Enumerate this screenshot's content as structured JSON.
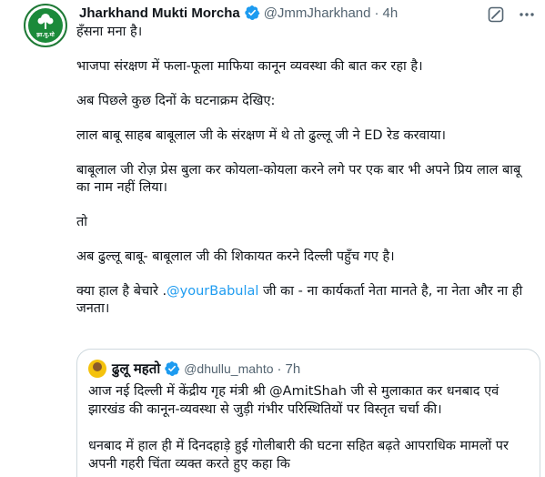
{
  "tweet": {
    "name": "Jharkhand Mukti Morcha",
    "handle": "@JmmJharkhand",
    "separator": "·",
    "time": "4h",
    "avatar_text": "झा.मु.मो",
    "paragraphs": [
      "हँसना मना है।",
      "भाजपा संरक्षण में फला-फूला माफिया कानून व्यवस्था की बात कर रहा है।",
      "अब पिछले कुछ दिनों के घटनाक्रम देखिए:",
      "लाल बाबू साहब बाबूलाल जी के संरक्षण में थे तो ढुल्लू जी ने ED रेड करवाया।",
      "बाबूलाल जी रोज़ प्रेस बुला कर कोयला-कोयला करने लगे पर एक बार भी अपने प्रिय लाल बाबू का नाम नहीं लिया।",
      "तो",
      "अब ढुल्लू बाबू- बाबूलाल जी की शिकायत करने दिल्ली पहुँच गए है।"
    ],
    "last_paragraph": {
      "before": "क्या हाल है बेचारे .",
      "mention": "@yourBabulal",
      "after": " जी का - ना कार्यकर्ता नेता मानते है, ना नेता और ना ही जनता।"
    }
  },
  "quote": {
    "name": "ढुलू महतो",
    "handle": "@dhullu_mahto",
    "separator": "·",
    "time": "7h",
    "paragraphs": [
      "आज नई दिल्ली में केंद्रीय गृह मंत्री श्री @AmitShah जी से मुलाकात कर धनबाद एवं झारखंड की कानून-व्यवस्था से जुड़ी गंभीर परिस्थितियों पर विस्तृत चर्चा की।",
      "धनबाद में हाल ही में दिनदहाड़े हुई गोलीबारी की घटना सहित बढ़ते आपराधिक मामलों पर अपनी गहरी चिंता व्यक्त करते हुए कहा कि"
    ]
  },
  "icons": {
    "verified": "verified-badge-icon",
    "grok": "grok-icon",
    "more": "more-icon"
  },
  "colors": {
    "verified": "#1d9bf0",
    "mention": "#1d9bf0",
    "secondary_text": "#536471"
  }
}
